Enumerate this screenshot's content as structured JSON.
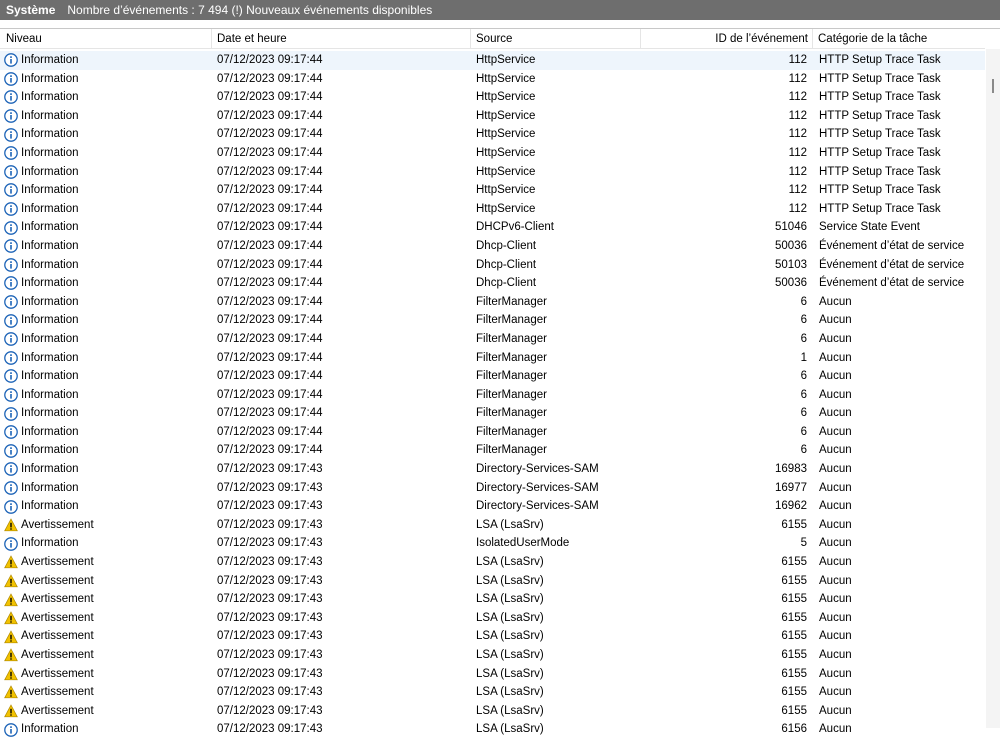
{
  "titlebar": {
    "name": "Système",
    "info": "Nombre d’événements : 7 494 (!) Nouveaux événements disponibles"
  },
  "columns": {
    "level": "Niveau",
    "date": "Date et heure",
    "source": "Source",
    "id": "ID de l’événement",
    "category": "Catégorie de la tâche"
  },
  "icons": {
    "info": "info-icon",
    "warning": "warning-icon"
  },
  "colors": {
    "info": "#1c63b7",
    "warning": "#f2c200",
    "selected": "#e5f3ff"
  },
  "rows": [
    {
      "level": "Information",
      "type": "info",
      "date": "07/12/2023 09:17:44",
      "source": "HttpService",
      "id": "112",
      "category": "HTTP Setup Trace Task"
    },
    {
      "level": "Information",
      "type": "info",
      "date": "07/12/2023 09:17:44",
      "source": "HttpService",
      "id": "112",
      "category": "HTTP Setup Trace Task"
    },
    {
      "level": "Information",
      "type": "info",
      "date": "07/12/2023 09:17:44",
      "source": "HttpService",
      "id": "112",
      "category": "HTTP Setup Trace Task"
    },
    {
      "level": "Information",
      "type": "info",
      "date": "07/12/2023 09:17:44",
      "source": "HttpService",
      "id": "112",
      "category": "HTTP Setup Trace Task"
    },
    {
      "level": "Information",
      "type": "info",
      "date": "07/12/2023 09:17:44",
      "source": "HttpService",
      "id": "112",
      "category": "HTTP Setup Trace Task"
    },
    {
      "level": "Information",
      "type": "info",
      "date": "07/12/2023 09:17:44",
      "source": "HttpService",
      "id": "112",
      "category": "HTTP Setup Trace Task"
    },
    {
      "level": "Information",
      "type": "info",
      "date": "07/12/2023 09:17:44",
      "source": "HttpService",
      "id": "112",
      "category": "HTTP Setup Trace Task"
    },
    {
      "level": "Information",
      "type": "info",
      "date": "07/12/2023 09:17:44",
      "source": "HttpService",
      "id": "112",
      "category": "HTTP Setup Trace Task"
    },
    {
      "level": "Information",
      "type": "info",
      "date": "07/12/2023 09:17:44",
      "source": "HttpService",
      "id": "112",
      "category": "HTTP Setup Trace Task"
    },
    {
      "level": "Information",
      "type": "info",
      "date": "07/12/2023 09:17:44",
      "source": "DHCPv6-Client",
      "id": "51046",
      "category": "Service State Event"
    },
    {
      "level": "Information",
      "type": "info",
      "date": "07/12/2023 09:17:44",
      "source": "Dhcp-Client",
      "id": "50036",
      "category": "Événement d’état de service"
    },
    {
      "level": "Information",
      "type": "info",
      "date": "07/12/2023 09:17:44",
      "source": "Dhcp-Client",
      "id": "50103",
      "category": "Événement d’état de service"
    },
    {
      "level": "Information",
      "type": "info",
      "date": "07/12/2023 09:17:44",
      "source": "Dhcp-Client",
      "id": "50036",
      "category": "Événement d’état de service"
    },
    {
      "level": "Information",
      "type": "info",
      "date": "07/12/2023 09:17:44",
      "source": "FilterManager",
      "id": "6",
      "category": "Aucun"
    },
    {
      "level": "Information",
      "type": "info",
      "date": "07/12/2023 09:17:44",
      "source": "FilterManager",
      "id": "6",
      "category": "Aucun"
    },
    {
      "level": "Information",
      "type": "info",
      "date": "07/12/2023 09:17:44",
      "source": "FilterManager",
      "id": "6",
      "category": "Aucun"
    },
    {
      "level": "Information",
      "type": "info",
      "date": "07/12/2023 09:17:44",
      "source": "FilterManager",
      "id": "1",
      "category": "Aucun"
    },
    {
      "level": "Information",
      "type": "info",
      "date": "07/12/2023 09:17:44",
      "source": "FilterManager",
      "id": "6",
      "category": "Aucun"
    },
    {
      "level": "Information",
      "type": "info",
      "date": "07/12/2023 09:17:44",
      "source": "FilterManager",
      "id": "6",
      "category": "Aucun"
    },
    {
      "level": "Information",
      "type": "info",
      "date": "07/12/2023 09:17:44",
      "source": "FilterManager",
      "id": "6",
      "category": "Aucun"
    },
    {
      "level": "Information",
      "type": "info",
      "date": "07/12/2023 09:17:44",
      "source": "FilterManager",
      "id": "6",
      "category": "Aucun"
    },
    {
      "level": "Information",
      "type": "info",
      "date": "07/12/2023 09:17:44",
      "source": "FilterManager",
      "id": "6",
      "category": "Aucun"
    },
    {
      "level": "Information",
      "type": "info",
      "date": "07/12/2023 09:17:43",
      "source": "Directory-Services-SAM",
      "id": "16983",
      "category": "Aucun"
    },
    {
      "level": "Information",
      "type": "info",
      "date": "07/12/2023 09:17:43",
      "source": "Directory-Services-SAM",
      "id": "16977",
      "category": "Aucun"
    },
    {
      "level": "Information",
      "type": "info",
      "date": "07/12/2023 09:17:43",
      "source": "Directory-Services-SAM",
      "id": "16962",
      "category": "Aucun"
    },
    {
      "level": "Avertissement",
      "type": "warning",
      "date": "07/12/2023 09:17:43",
      "source": "LSA (LsaSrv)",
      "id": "6155",
      "category": "Aucun"
    },
    {
      "level": "Information",
      "type": "info",
      "date": "07/12/2023 09:17:43",
      "source": "IsolatedUserMode",
      "id": "5",
      "category": "Aucun"
    },
    {
      "level": "Avertissement",
      "type": "warning",
      "date": "07/12/2023 09:17:43",
      "source": "LSA (LsaSrv)",
      "id": "6155",
      "category": "Aucun"
    },
    {
      "level": "Avertissement",
      "type": "warning",
      "date": "07/12/2023 09:17:43",
      "source": "LSA (LsaSrv)",
      "id": "6155",
      "category": "Aucun"
    },
    {
      "level": "Avertissement",
      "type": "warning",
      "date": "07/12/2023 09:17:43",
      "source": "LSA (LsaSrv)",
      "id": "6155",
      "category": "Aucun"
    },
    {
      "level": "Avertissement",
      "type": "warning",
      "date": "07/12/2023 09:17:43",
      "source": "LSA (LsaSrv)",
      "id": "6155",
      "category": "Aucun"
    },
    {
      "level": "Avertissement",
      "type": "warning",
      "date": "07/12/2023 09:17:43",
      "source": "LSA (LsaSrv)",
      "id": "6155",
      "category": "Aucun"
    },
    {
      "level": "Avertissement",
      "type": "warning",
      "date": "07/12/2023 09:17:43",
      "source": "LSA (LsaSrv)",
      "id": "6155",
      "category": "Aucun"
    },
    {
      "level": "Avertissement",
      "type": "warning",
      "date": "07/12/2023 09:17:43",
      "source": "LSA (LsaSrv)",
      "id": "6155",
      "category": "Aucun"
    },
    {
      "level": "Avertissement",
      "type": "warning",
      "date": "07/12/2023 09:17:43",
      "source": "LSA (LsaSrv)",
      "id": "6155",
      "category": "Aucun"
    },
    {
      "level": "Avertissement",
      "type": "warning",
      "date": "07/12/2023 09:17:43",
      "source": "LSA (LsaSrv)",
      "id": "6155",
      "category": "Aucun"
    },
    {
      "level": "Information",
      "type": "info",
      "date": "07/12/2023 09:17:43",
      "source": "LSA (LsaSrv)",
      "id": "6156",
      "category": "Aucun"
    }
  ]
}
